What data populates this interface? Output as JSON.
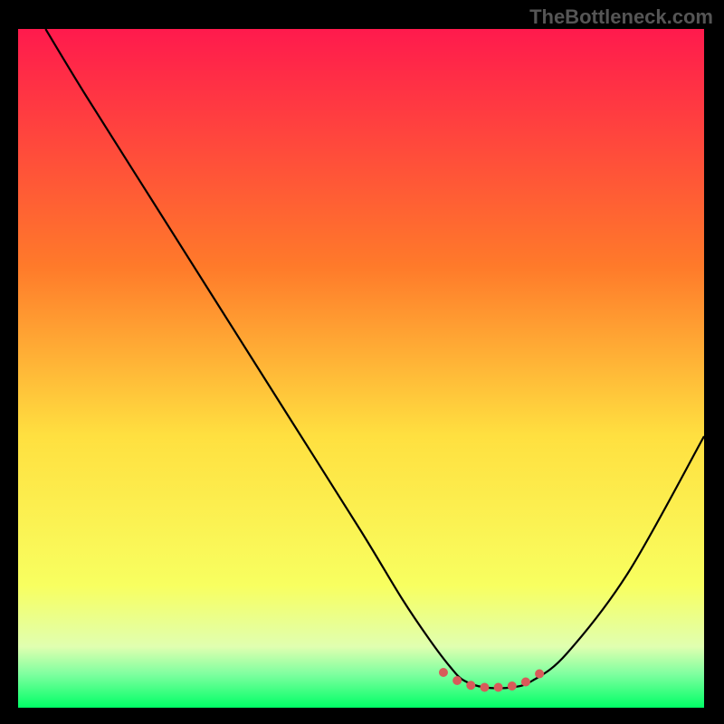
{
  "watermark": "TheBottleneck.com",
  "chart_data": {
    "type": "line",
    "title": "",
    "xlabel": "",
    "ylabel": "",
    "xlim": [
      0,
      100
    ],
    "ylim": [
      0,
      100
    ],
    "background_gradient_stops": [
      {
        "offset": 0,
        "color": "#ff1a4d"
      },
      {
        "offset": 35,
        "color": "#ff7a2a"
      },
      {
        "offset": 60,
        "color": "#ffe040"
      },
      {
        "offset": 82,
        "color": "#f8ff60"
      },
      {
        "offset": 91,
        "color": "#e0ffb0"
      },
      {
        "offset": 95,
        "color": "#80ffa0"
      },
      {
        "offset": 100,
        "color": "#00ff66"
      }
    ],
    "series": [
      {
        "name": "bottleneck-curve",
        "x": [
          4,
          10,
          20,
          30,
          40,
          50,
          56,
          60,
          63,
          65,
          68,
          72,
          75,
          80,
          89,
          100
        ],
        "y": [
          100,
          90,
          74,
          58,
          42,
          26,
          16,
          10,
          6,
          4,
          3,
          3,
          4,
          8,
          20,
          40
        ]
      }
    ],
    "markers": {
      "name": "flat-region",
      "color": "#d85a5a",
      "points": [
        {
          "x": 62,
          "y": 5.2
        },
        {
          "x": 64,
          "y": 4.0
        },
        {
          "x": 66,
          "y": 3.3
        },
        {
          "x": 68,
          "y": 3.0
        },
        {
          "x": 70,
          "y": 3.0
        },
        {
          "x": 72,
          "y": 3.2
        },
        {
          "x": 74,
          "y": 3.8
        },
        {
          "x": 76,
          "y": 5.0
        }
      ]
    }
  }
}
